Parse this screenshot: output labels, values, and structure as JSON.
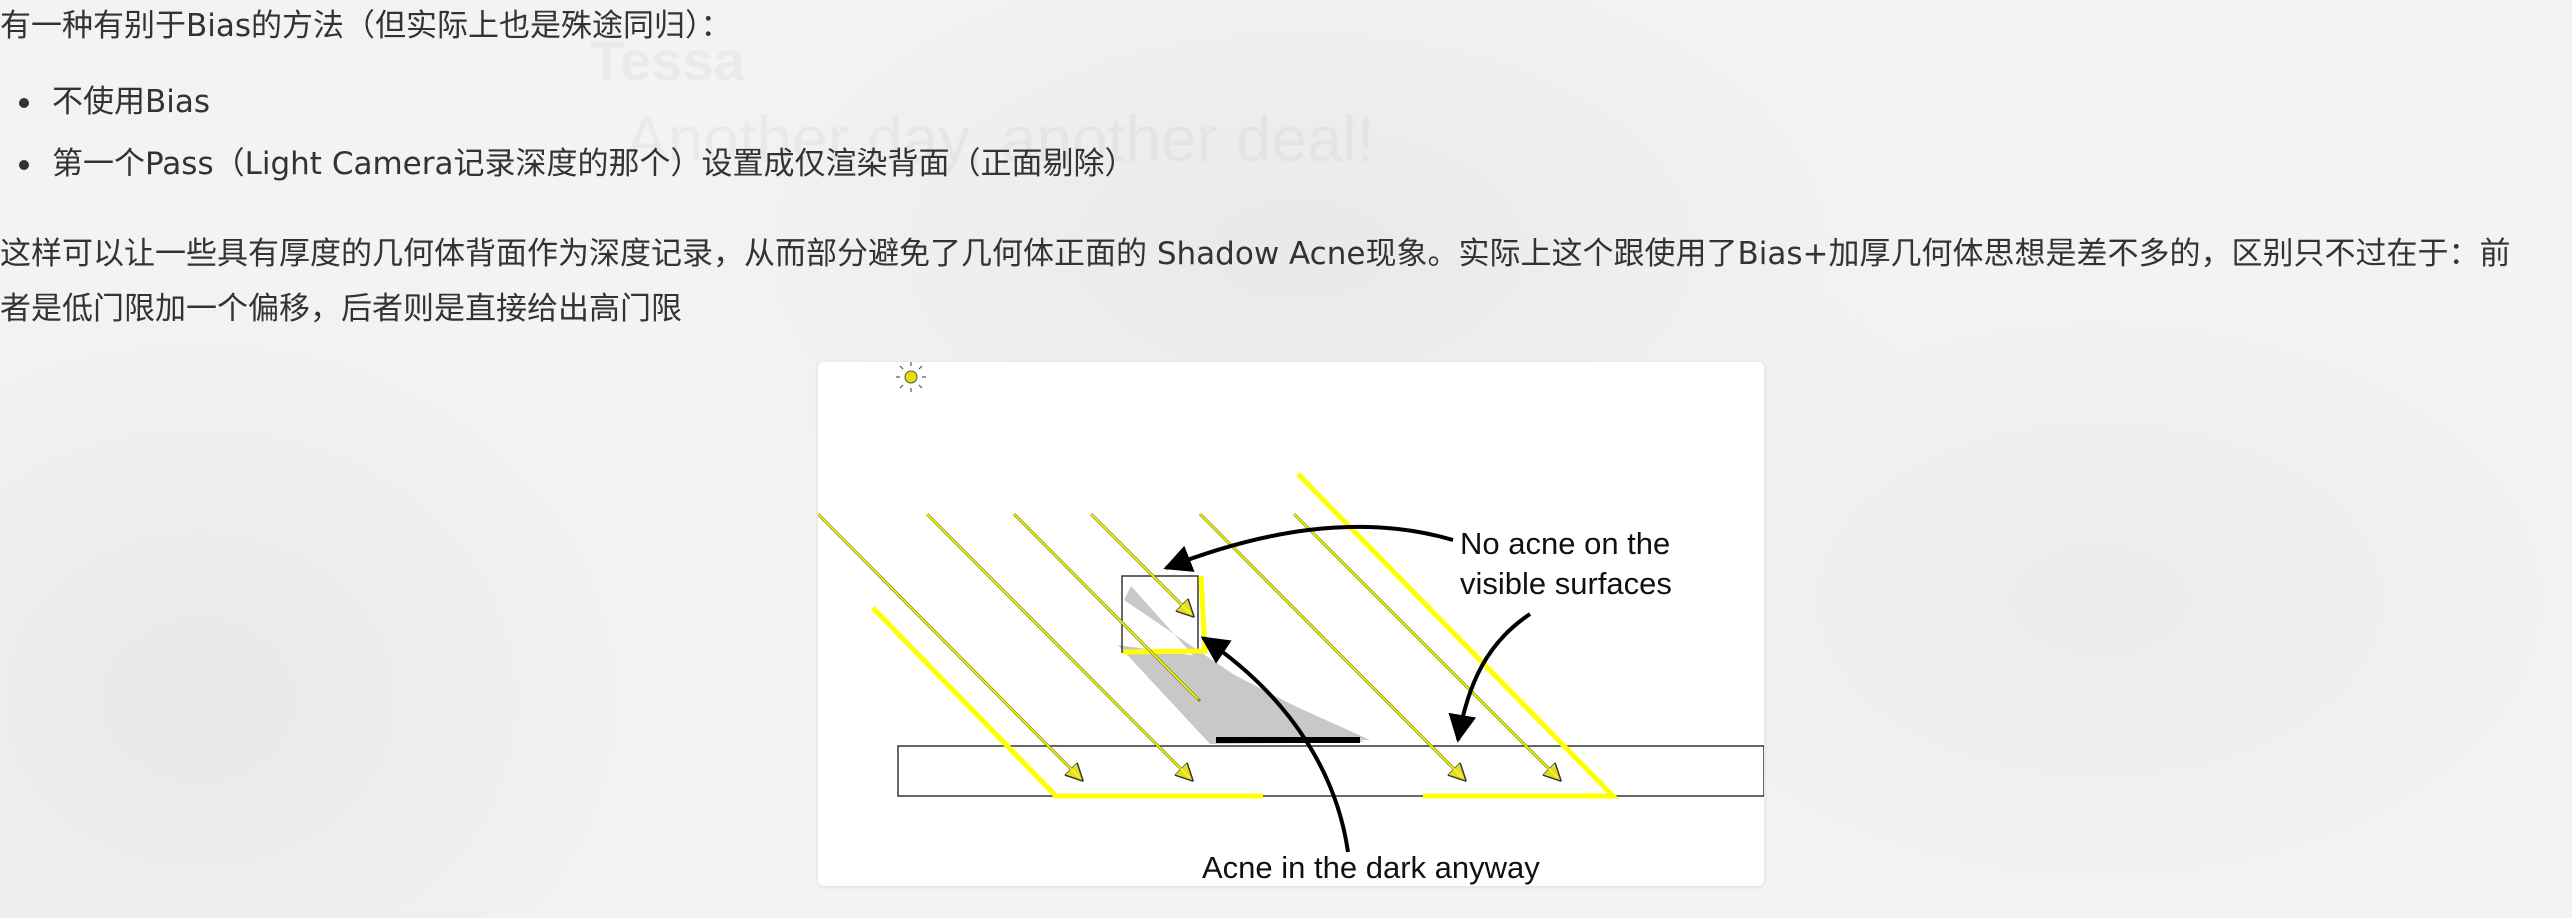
{
  "background": {
    "watermark_title": "Tessa",
    "watermark_subtitle": "Another day, another deal!"
  },
  "intro": "有一种有别于Bias的方法（但实际上也是殊途同归）：",
  "bullets": [
    "不使用Bias",
    "第一个Pass（Light Camera记录深度的那个）设置成仅渲染背面（正面剔除）"
  ],
  "paragraph": {
    "line1": "这样可以让一些具有厚度的几何体背面作为深度记录，从而部分避免了几何体正面的 Shadow Acne现象。实际上这个跟使用了Bias+加厚几何体思想是差不多的，区别只不过在于：前",
    "line2": "者是低门限加一个偏移，后者则是直接给出高门限"
  },
  "figure": {
    "label_no_acne_1": "No acne on the",
    "label_no_acne_2": "visible surfaces",
    "label_acne_dark": "Acne in the dark anyway",
    "colors": {
      "light_ray": "#ffff00",
      "ray_arrow": "#d8d23a",
      "shadow_fill": "#c8c8c8",
      "sun": "#e8e000"
    }
  }
}
